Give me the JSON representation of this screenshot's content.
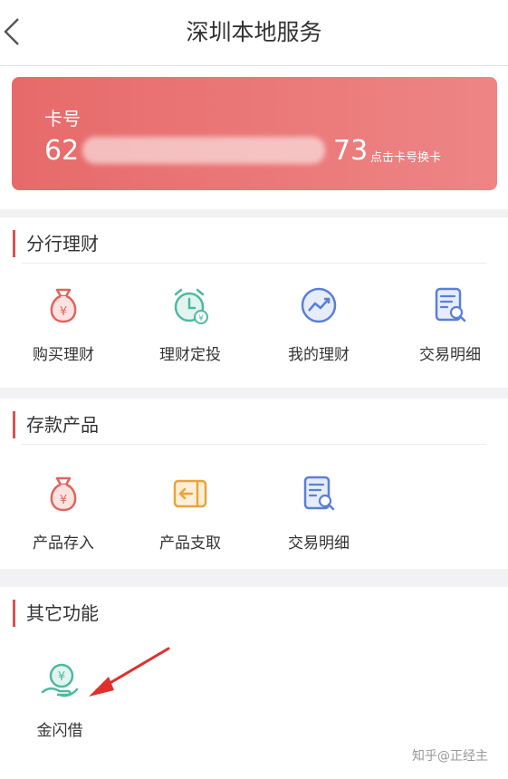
{
  "header": {
    "title": "深圳本地服务"
  },
  "card": {
    "label": "卡号",
    "number_head": "62",
    "number_tail": "73",
    "hint": "点击卡号换卡"
  },
  "sections": [
    {
      "title": "分行理财",
      "items": [
        "购买理财",
        "理财定投",
        "我的理财",
        "交易明细"
      ]
    },
    {
      "title": "存款产品",
      "items": [
        "产品存入",
        "产品支取",
        "交易明细"
      ]
    },
    {
      "title": "其它功能",
      "items": [
        "金闪借"
      ]
    }
  ],
  "icons": {
    "sec0": [
      "money-bag-icon",
      "alarm-clock-yen-icon",
      "trend-chart-icon",
      "document-search-icon"
    ],
    "sec1": [
      "money-bag-icon",
      "transfer-out-icon",
      "document-search-icon"
    ],
    "sec2": [
      "hand-coin-icon"
    ]
  },
  "colors": {
    "card": "#e76a6a",
    "accent": "#d9534f",
    "red_icon": "#e0645c",
    "green_icon": "#4cbaa0",
    "blue_icon": "#5b7fd6",
    "orange_icon": "#e8a43a"
  },
  "watermark": "知乎@正经主"
}
